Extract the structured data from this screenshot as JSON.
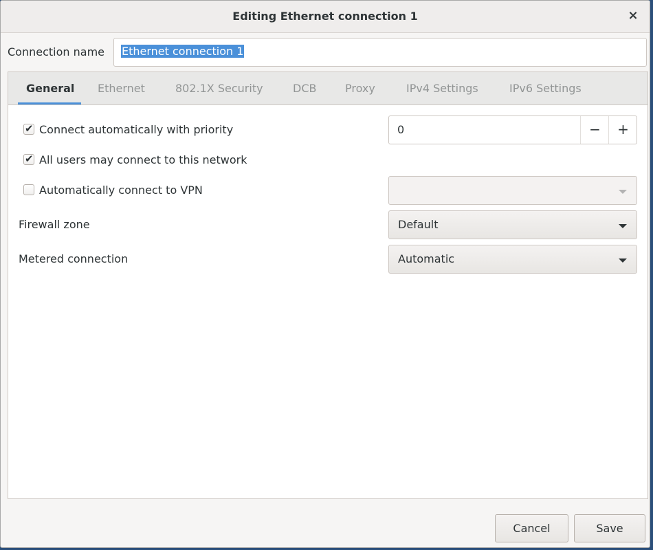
{
  "window": {
    "title": "Editing Ethernet connection 1",
    "close_glyph": "×"
  },
  "connection_name": {
    "label": "Connection name",
    "value": "Ethernet connection 1"
  },
  "tabs": [
    {
      "label": "General",
      "active": true
    },
    {
      "label": "Ethernet",
      "active": false
    },
    {
      "label": "802.1X Security",
      "active": false
    },
    {
      "label": "DCB",
      "active": false
    },
    {
      "label": "Proxy",
      "active": false
    },
    {
      "label": "IPv4 Settings",
      "active": false
    },
    {
      "label": "IPv6 Settings",
      "active": false
    }
  ],
  "general": {
    "connect_auto": {
      "label": "Connect automatically with priority",
      "checked": true
    },
    "priority": {
      "value": "0",
      "minus": "−",
      "plus": "+"
    },
    "all_users": {
      "label": "All users may connect to this network",
      "checked": true
    },
    "auto_vpn": {
      "label": "Automatically connect to VPN",
      "checked": false,
      "value": ""
    },
    "firewall_zone": {
      "label": "Firewall zone",
      "value": "Default"
    },
    "metered": {
      "label": "Metered connection",
      "value": "Automatic"
    }
  },
  "buttons": {
    "cancel": "Cancel",
    "save": "Save"
  },
  "colors": {
    "accent": "#4a90d9",
    "dialog_bg": "#f6f5f4"
  },
  "icons": {
    "checkmark": "✔"
  }
}
